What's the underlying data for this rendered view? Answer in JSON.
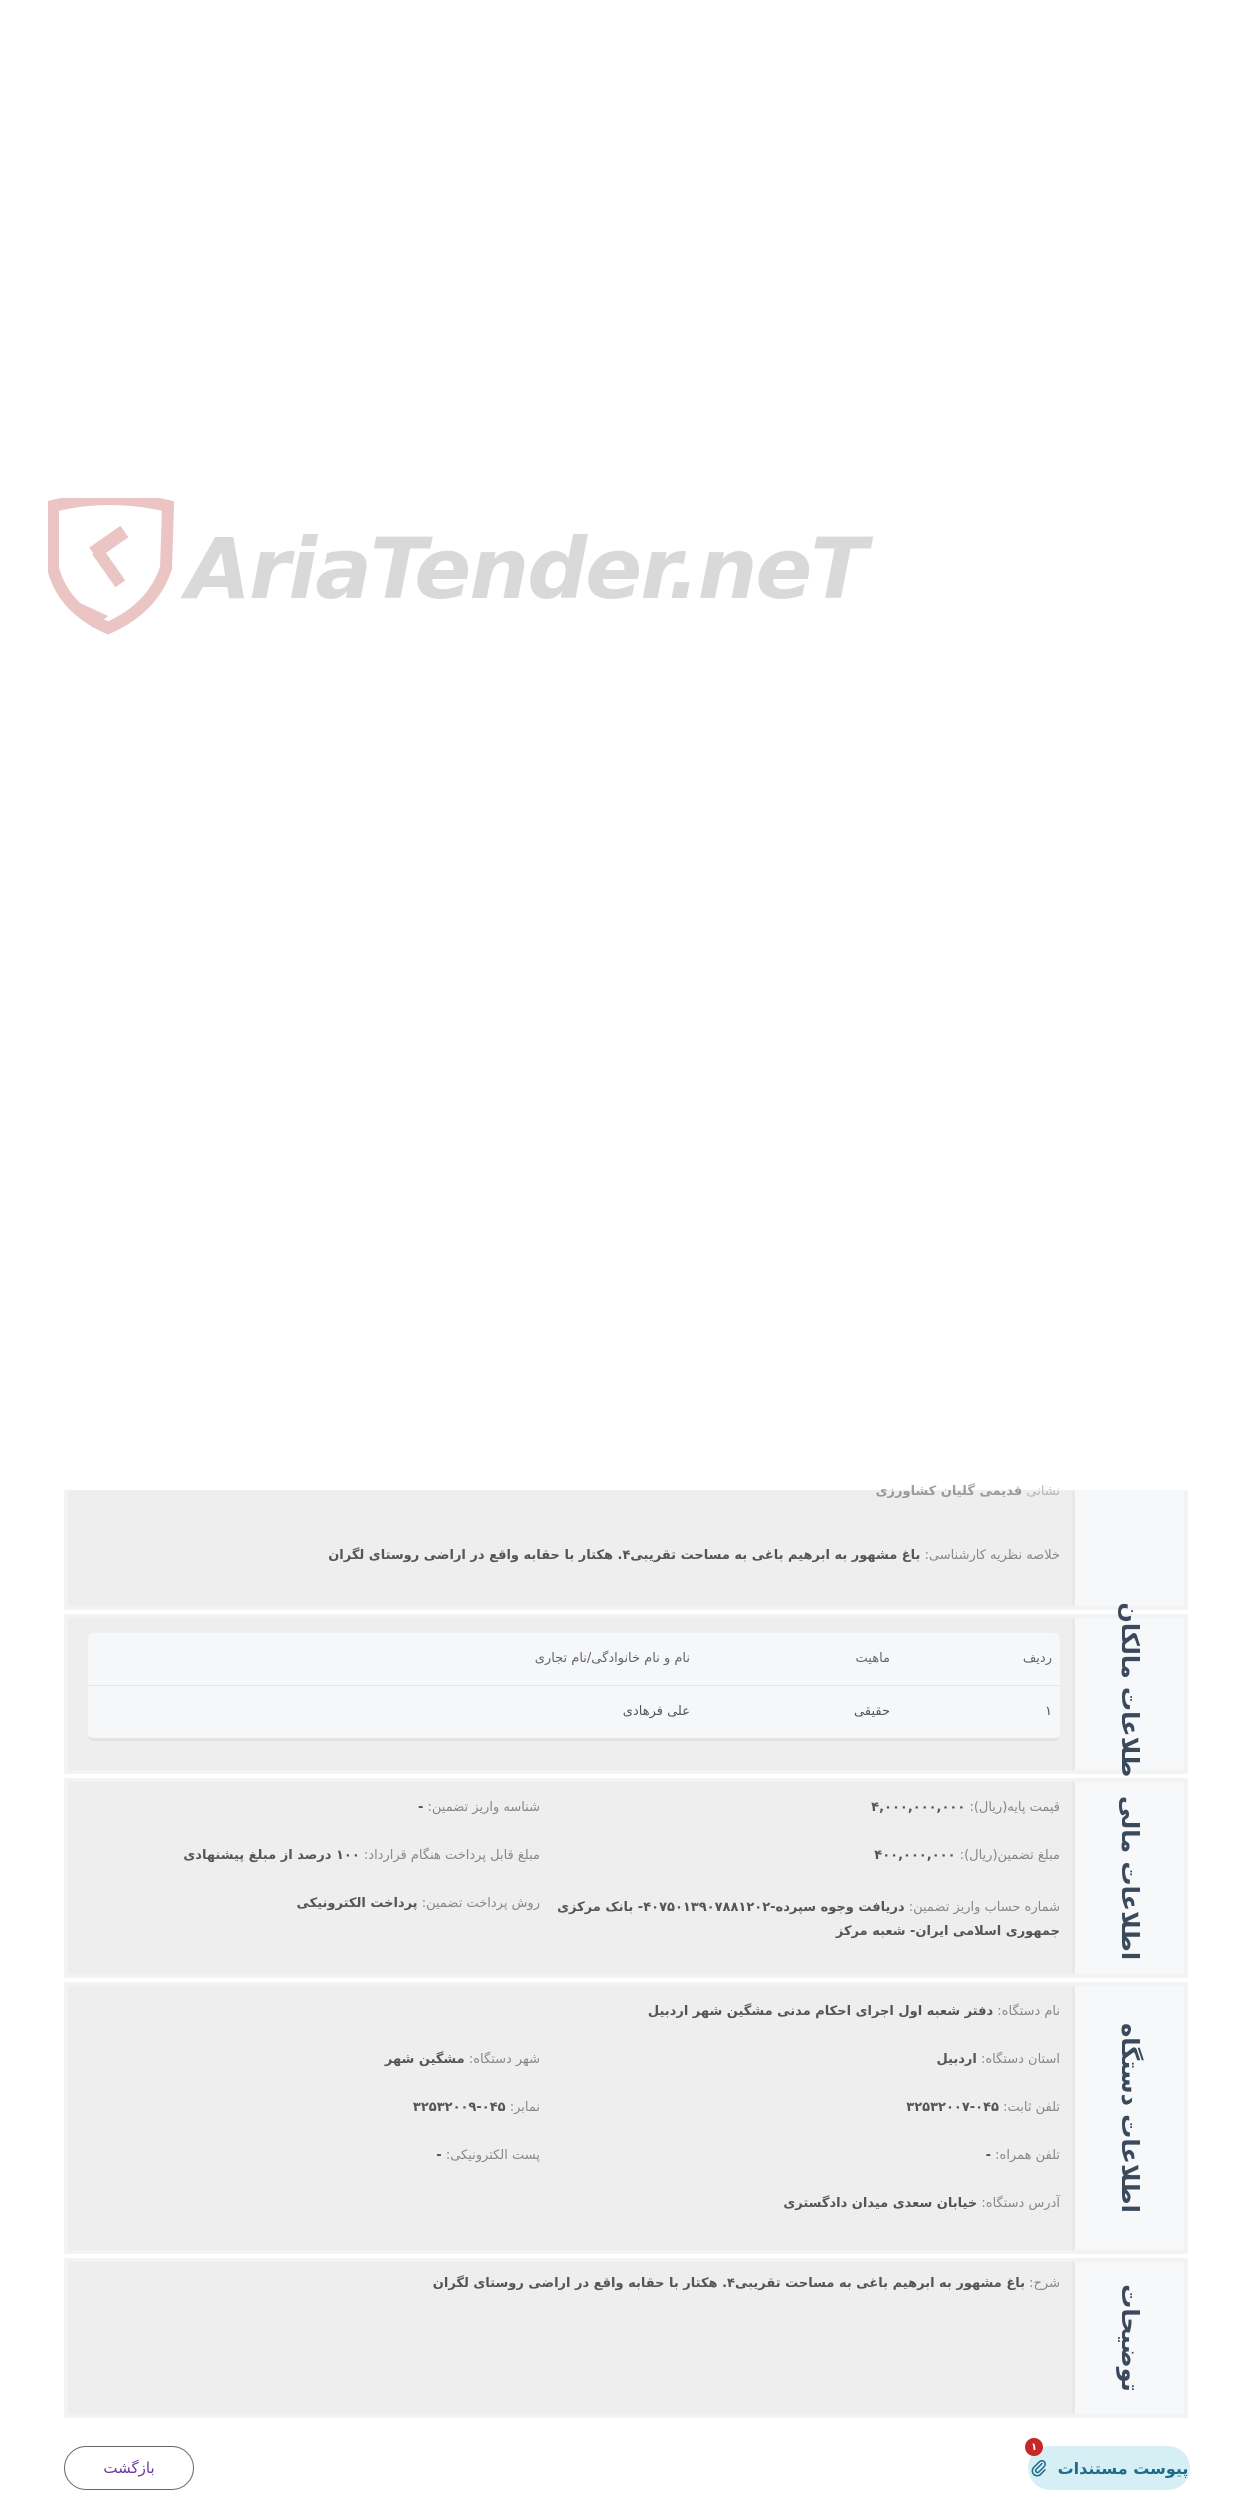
{
  "watermark": {
    "brand": "AriaTender.neT"
  },
  "summary": {
    "partial_label": "نشانی",
    "partial_value": "قدیمی گلیان کشاورزی",
    "label": "خلاصه نظریه کارشناسی:",
    "value": "باغ مشهور به ابرهیم باغی به مساحت تقریبی۴. هکتار با حقابه واقع در اراضی روستای لگران"
  },
  "owners": {
    "title": "اطلاعات مالکان",
    "columns": [
      "ردیف",
      "ماهیت",
      "نام و نام خانوادگی/نام تجاری"
    ],
    "rows": [
      {
        "index": "۱",
        "type": "حقیقی",
        "name": "علی فرهادی"
      }
    ]
  },
  "financial": {
    "title": "اطلاعات مالی",
    "base_price_label": "قیمت پایه(ریال):",
    "base_price_value": "۴,۰۰۰,۰۰۰,۰۰۰",
    "deposit_id_label": "شناسه واریز تضمین:",
    "deposit_id_value": "-",
    "guarantee_label": "مبلغ تضمین(ریال):",
    "guarantee_value": "۴۰۰,۰۰۰,۰۰۰",
    "payable_label": "مبلغ قابل پرداخت هنگام قرارداد:",
    "payable_value": "۱۰۰ درصد از مبلغ پیشنهادی",
    "account_label": "شماره حساب واریز تضمین:",
    "account_value_1": "دریافت وجوه سپرده-۴۰۷۵۰۱۳۹۰۷۸۸۱۲۰۲- بانک مرکزی",
    "account_value_2": "جمهوری اسلامی ایران- شعبه مرکز",
    "method_label": "روش پرداخت تضمین:",
    "method_value": "پرداخت الکترونیکی"
  },
  "organization": {
    "title": "اطلاعات دستگاه",
    "name_label": "نام دستگاه:",
    "name_value": "دفتر شعبه اول اجرای احکام مدنی مشگین شهر اردبیل",
    "province_label": "استان دستگاه:",
    "province_value": "اردبیل",
    "city_label": "شهر دستگاه:",
    "city_value": "مشگین شهر",
    "phone_label": "تلفن ثابت:",
    "phone_value": "۰۴۵-۳۲۵۳۲۰۰۷",
    "fax_label": "نمابر:",
    "fax_value": "۰۴۵-۳۲۵۳۲۰۰۹",
    "mobile_label": "تلفن همراه:",
    "mobile_value": "-",
    "email_label": "پست الکترونیکی:",
    "email_value": "-",
    "address_label": "آدرس دستگاه:",
    "address_value": "خیابان سعدی میدان دادگستری"
  },
  "descriptions": {
    "title": "توضیحات",
    "label": "شرح:",
    "value": "باغ مشهور به ابرهیم باغی به مساحت تقریبی۴. هکتار با حقابه واقع در اراضی روستای لگران"
  },
  "actions": {
    "attach_label": "پیوست مستندات",
    "attach_count": "۱",
    "back_label": "بازگشت"
  },
  "colors": {
    "section_bg": "#eeeeee",
    "side_bg": "#f7f8fa",
    "title": "#3a4a5c",
    "attach_bg": "#d5eff4",
    "badge": "#c62828",
    "watermark_red": "#e8b8b8"
  }
}
